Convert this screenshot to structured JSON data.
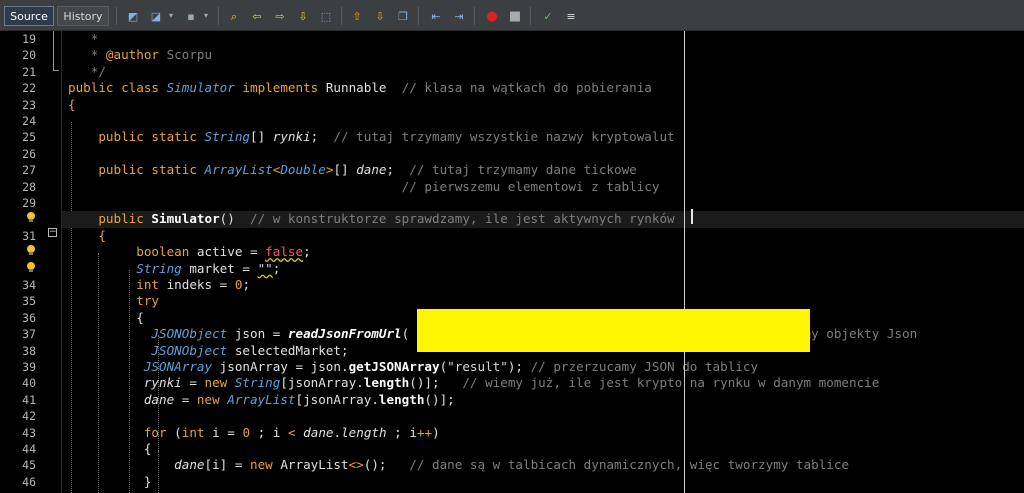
{
  "tabs": {
    "source": "Source",
    "history": "History"
  },
  "toolbar_icons": [
    "back-history-icon",
    "forward-history-icon",
    "last-edit-icon",
    "find-icon",
    "find-prev-icon",
    "find-next-icon",
    "toggle-highlight-icon",
    "find-selection-icon",
    "shift-left-icon",
    "shift-right-icon",
    "toggle-bookmark-icon",
    "prev-bookmark-icon",
    "next-bookmark-icon",
    "record-macro-icon",
    "stop-macro-icon",
    "comment-icon",
    "uncomment-icon"
  ],
  "gutter": {
    "lines": [
      "19",
      "20",
      "21",
      "22",
      "23",
      "24",
      "25",
      "26",
      "27",
      "28",
      "29",
      "",
      "31",
      "",
      "",
      "34",
      "35",
      "36",
      "37",
      "38",
      "39",
      "40",
      "41",
      "42",
      "43",
      "44",
      "45",
      "46"
    ],
    "fold_marker": "−"
  },
  "code": [
    {
      "line": "19",
      "tokens": [
        [
          "co",
          "   *"
        ]
      ]
    },
    {
      "line": "20",
      "tokens": [
        [
          "co",
          "   * "
        ],
        [
          "an",
          "@author"
        ],
        [
          "co",
          " Scorpu"
        ]
      ]
    },
    {
      "line": "21",
      "tokens": [
        [
          "co",
          "   */"
        ]
      ]
    },
    {
      "line": "22",
      "tokens": [
        [
          "kw",
          "public class "
        ],
        [
          "it",
          "Simulator"
        ],
        [
          "kw",
          " implements "
        ],
        [
          "nm",
          "Runnable  "
        ],
        [
          "co",
          "// klasa na wątkach do pobierania"
        ]
      ]
    },
    {
      "line": "23",
      "tokens": [
        [
          "kw",
          "{"
        ]
      ]
    },
    {
      "line": "24",
      "tokens": []
    },
    {
      "line": "25",
      "tokens": [
        [
          "nm",
          "    "
        ],
        [
          "kw",
          "public static "
        ],
        [
          "it",
          "String"
        ],
        [
          "nm",
          "[] "
        ],
        [
          "ii",
          "rynki"
        ],
        [
          "nm",
          ";  "
        ],
        [
          "co",
          "// tutaj trzymamy wszystkie nazwy kryptowalut"
        ]
      ]
    },
    {
      "line": "26",
      "tokens": []
    },
    {
      "line": "27",
      "tokens": [
        [
          "nm",
          "    "
        ],
        [
          "kw",
          "public static "
        ],
        [
          "it",
          "ArrayList"
        ],
        [
          "kw",
          "<"
        ],
        [
          "it",
          "Double"
        ],
        [
          "kw",
          ">"
        ],
        [
          "nm",
          "[] "
        ],
        [
          "ii",
          "dane"
        ],
        [
          "nm",
          ";  "
        ],
        [
          "co",
          "// tutaj trzymamy dane tickowe"
        ]
      ]
    },
    {
      "line": "28",
      "tokens": [
        [
          "nm",
          "                                            "
        ],
        [
          "co",
          "// pierwszemu elementowi z tablicy"
        ]
      ]
    },
    {
      "line": "29",
      "tokens": []
    },
    {
      "line": "30",
      "tokens": [
        [
          "nm",
          "    "
        ],
        [
          "kw",
          "public "
        ],
        [
          "bd",
          "Simulator"
        ],
        [
          "nm",
          "()  "
        ],
        [
          "co",
          "// w konstruktorze sprawdzamy, ile jest aktywnych rynków"
        ]
      ]
    },
    {
      "line": "31",
      "tokens": [
        [
          "nm",
          "    "
        ],
        [
          "kw",
          "{"
        ]
      ]
    },
    {
      "line": "32",
      "tokens": [
        [
          "nm",
          "         "
        ],
        [
          "kw",
          "boolean "
        ],
        [
          "nm",
          "active = "
        ],
        [
          "sx",
          "false"
        ],
        [
          "nm",
          ";"
        ]
      ]
    },
    {
      "line": "33",
      "tokens": [
        [
          "nm",
          "         "
        ],
        [
          "it",
          "String"
        ],
        [
          "nm",
          " market = "
        ],
        [
          "st",
          "\"\""
        ],
        [
          "nm",
          ";"
        ]
      ]
    },
    {
      "line": "34",
      "tokens": [
        [
          "nm",
          "         "
        ],
        [
          "kw",
          "int "
        ],
        [
          "nm",
          "indeks = "
        ],
        [
          "kw",
          "0"
        ],
        [
          "nm",
          ";"
        ]
      ]
    },
    {
      "line": "35",
      "tokens": [
        [
          "nm",
          "         "
        ],
        [
          "kw",
          "try"
        ]
      ]
    },
    {
      "line": "36",
      "tokens": [
        [
          "nm",
          "         {"
        ]
      ]
    },
    {
      "line": "37",
      "tokens": [
        [
          "nm",
          "           "
        ],
        [
          "it",
          "JSONObject"
        ],
        [
          "nm",
          " json = "
        ],
        [
          "bi",
          "readJsonFromUrl"
        ],
        [
          "nm",
          "(                                          "
        ],
        [
          "co",
          "// pobieramy objekty Json"
        ]
      ]
    },
    {
      "line": "38",
      "tokens": [
        [
          "nm",
          "           "
        ],
        [
          "it",
          "JSONObject"
        ],
        [
          "nm",
          " selectedMarket;"
        ]
      ]
    },
    {
      "line": "39",
      "tokens": [
        [
          "nm",
          "          "
        ],
        [
          "it",
          "JSONArray"
        ],
        [
          "nm",
          " jsonArray = json."
        ],
        [
          "bd",
          "getJSONArray"
        ],
        [
          "nm",
          "("
        ],
        [
          "st",
          "\"result\""
        ],
        [
          "nm",
          "); "
        ],
        [
          "co",
          "// przerzucamy JSON do tablicy"
        ]
      ]
    },
    {
      "line": "40",
      "tokens": [
        [
          "nm",
          "          "
        ],
        [
          "ii",
          "rynki"
        ],
        [
          "nm",
          " = "
        ],
        [
          "kw",
          "new "
        ],
        [
          "it",
          "String"
        ],
        [
          "nm",
          "[jsonArray."
        ],
        [
          "bd",
          "length"
        ],
        [
          "nm",
          "()];   "
        ],
        [
          "co",
          "// wiemy już, ile jest krypto na rynku w danym momencie"
        ]
      ]
    },
    {
      "line": "41",
      "tokens": [
        [
          "nm",
          "          "
        ],
        [
          "ii",
          "dane"
        ],
        [
          "nm",
          " = "
        ],
        [
          "kw",
          "new "
        ],
        [
          "it",
          "ArrayList"
        ],
        [
          "nm",
          "[jsonArray."
        ],
        [
          "bd",
          "length"
        ],
        [
          "nm",
          "()];"
        ]
      ]
    },
    {
      "line": "42",
      "tokens": []
    },
    {
      "line": "43",
      "tokens": [
        [
          "nm",
          "          "
        ],
        [
          "kw",
          "for "
        ],
        [
          "nm",
          "("
        ],
        [
          "kw",
          "int "
        ],
        [
          "nm",
          "i = "
        ],
        [
          "kw",
          "0"
        ],
        [
          "nm",
          " ; i "
        ],
        [
          "kw",
          "<"
        ],
        [
          "nm",
          " "
        ],
        [
          "ii",
          "dane"
        ],
        [
          "nm",
          "."
        ],
        [
          "ii",
          "length"
        ],
        [
          "nm",
          " ; i"
        ],
        [
          "kw",
          "++"
        ],
        [
          "nm",
          ")"
        ]
      ]
    },
    {
      "line": "44",
      "tokens": [
        [
          "nm",
          "          {"
        ]
      ]
    },
    {
      "line": "45",
      "tokens": [
        [
          "nm",
          "              "
        ],
        [
          "ii",
          "dane"
        ],
        [
          "nm",
          "[i] = "
        ],
        [
          "kw",
          "new "
        ],
        [
          "nm",
          "ArrayList"
        ],
        [
          "kw",
          "<>"
        ],
        [
          "nm",
          "();   "
        ],
        [
          "co",
          "// dane są w talbicach dynamicznych, więc tworzymy tablice"
        ]
      ]
    },
    {
      "line": "46",
      "tokens": [
        [
          "nm",
          "          }"
        ]
      ]
    }
  ]
}
